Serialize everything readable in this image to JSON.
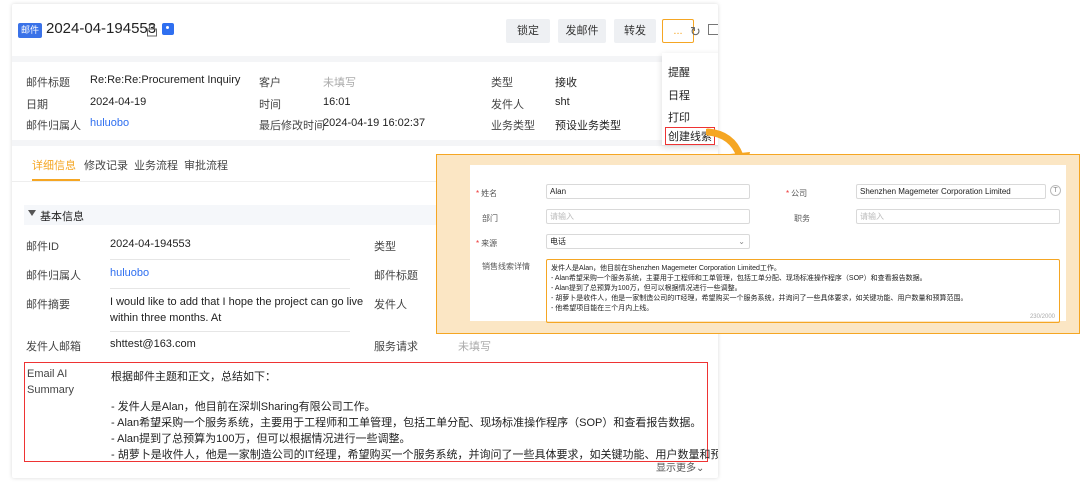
{
  "header": {
    "badge": "邮件",
    "title": "2024-04-194553",
    "buttons": {
      "lock": "锁定",
      "send": "发邮件",
      "forward": "转发",
      "more": "..."
    }
  },
  "info": {
    "subject_label": "邮件标题",
    "subject_value": "Re:Re:Re:Procurement Inquiry",
    "customer_label": "客户",
    "customer_value": "未填写",
    "type_label": "类型",
    "type_value": "接收",
    "date_label": "日期",
    "date_value": "2024-04-19",
    "time_label": "时间",
    "time_value": "16:01",
    "sender_label": "发件人",
    "sender_value": "sht",
    "owner_label": "邮件归属人",
    "owner_value": "huluobo",
    "modified_label": "最后修改时间",
    "modified_value": "2024-04-19 16:02:37",
    "biztype_label": "业务类型",
    "biztype_value": "预设业务类型"
  },
  "tabs": [
    "详细信息",
    "修改记录",
    "业务流程",
    "审批流程"
  ],
  "section": {
    "title": "基本信息"
  },
  "detail": {
    "id_label": "邮件ID",
    "id_value": "2024-04-194553",
    "type_label": "类型",
    "owner_label": "邮件归属人",
    "owner_value": "huluobo",
    "subject_label": "邮件标题",
    "summary_label": "邮件摘要",
    "summary_line1": "I would like to add that I hope the project can go live",
    "summary_line2": "within three months. At",
    "sender_label": "发件人",
    "email_label": "发件人邮箱",
    "email_value": "shttest@163.com",
    "service_label": "服务请求",
    "service_value": "未填写"
  },
  "ai": {
    "label_line1": "Email AI",
    "label_line2": "Summary",
    "lines": [
      "根据邮件主题和正文，总结如下：",
      "- 发件人是Alan，他目前在深圳Sharing有限公司工作。",
      "- Alan希望采购一个服务系统，主要用于工程师和工单管理，包括工单分配、现场标准操作程序（SOP）和查看报告数据。",
      "- Alan提到了总预算为100万，但可以根据情况进行一些调整。",
      "- 胡萝卜是收件人，他是一家制造公司的IT经理，希望购买一个服务系统，并询问了一些具体要求，如关键功能、用户数量和预算范围..."
    ],
    "show_more": "显示更多"
  },
  "dropdown": {
    "items": [
      "提醒",
      "日程",
      "打印",
      "创建线索"
    ]
  },
  "lead_form": {
    "name_label": "姓名",
    "name_value": "Alan",
    "company_label": "公司",
    "company_value": "Shenzhen Magemeter Corporation Limited",
    "dept_label": "部门",
    "dept_placeholder": "请输入",
    "position_label": "职务",
    "position_placeholder": "请输入",
    "source_label": "来源",
    "source_value": "电话",
    "details_label": "销售线索详情",
    "details_lines": [
      "发件人是Alan，他目前在Shenzhen Magemeter Corporation Limited工作。",
      "- Alan希望采购一个服务系统，主要用于工程师和工单管理，包括工单分配、现场标准操作程序（SOP）和查看报告数据。",
      "- Alan提到了总预算为100万，但可以根据情况进行一些调整。",
      "- 胡萝卜是收件人，他是一家制造公司的IT经理，希望购买一个服务系统，并询问了一些具体要求，如关键功能、用户数量和预算范围。",
      "- 他希望项目能在三个月内上线。"
    ],
    "char_count": "230/2000"
  },
  "colors": {
    "accent": "#f5a623",
    "link": "#2f6ff0",
    "highlight": "#ee3333",
    "badge": "#3a72e8"
  }
}
